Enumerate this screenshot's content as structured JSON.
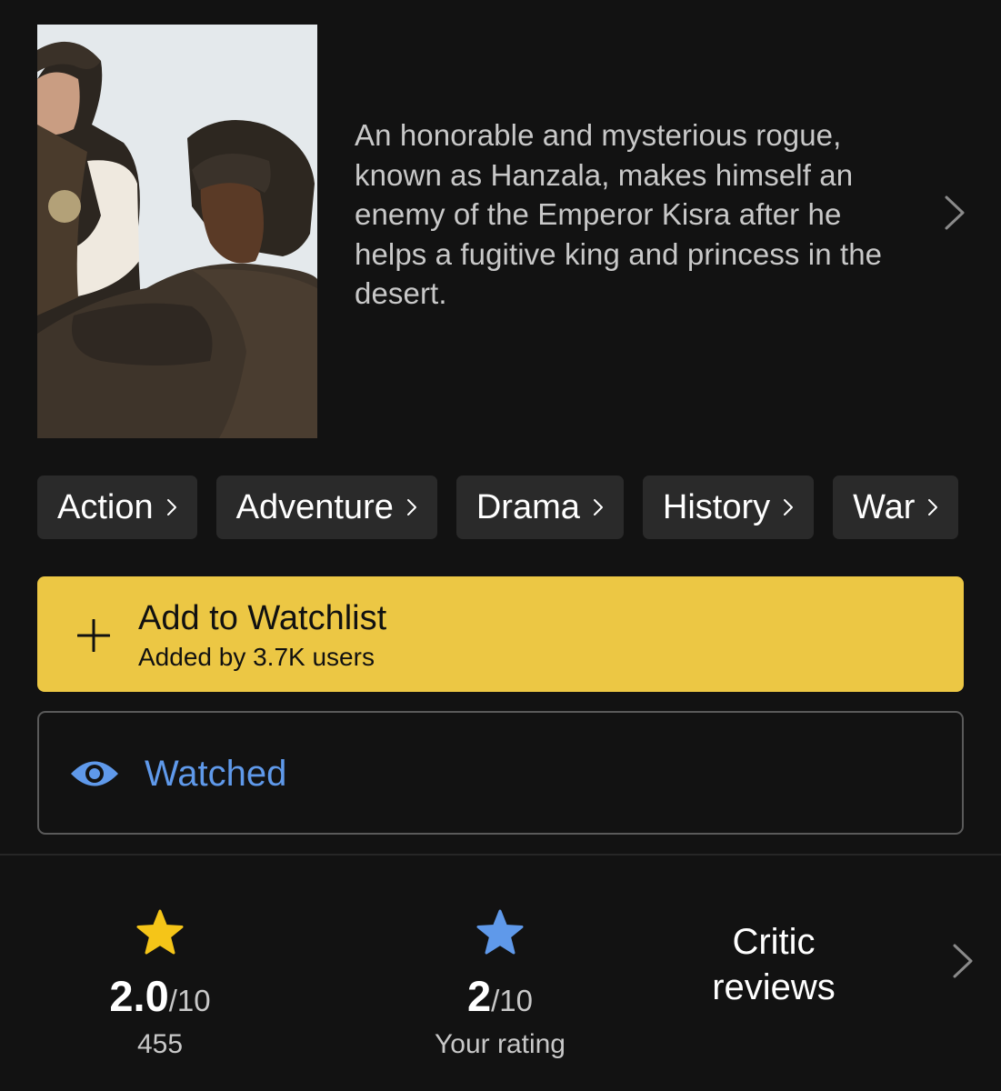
{
  "plot": {
    "text": "An honorable and mysterious rogue, known as Hanzala, makes himself an enemy of the Emperor Kisra after he helps a fugitive king and princess in the desert."
  },
  "genres": [
    {
      "label": "Action"
    },
    {
      "label": "Adventure"
    },
    {
      "label": "Drama"
    },
    {
      "label": "History"
    },
    {
      "label": "War"
    }
  ],
  "watchlist": {
    "title": "Add to Watchlist",
    "subtitle": "Added by 3.7K users",
    "icon": "plus-icon",
    "color": "#ecc744"
  },
  "watched": {
    "label": "Watched",
    "icon": "eye-icon",
    "color": "#5f99ea"
  },
  "ratings": {
    "imdb": {
      "score": "2.0",
      "out_of": "/10",
      "count": "455",
      "icon": "star-icon",
      "color": "#f5c518"
    },
    "user": {
      "score": "2",
      "out_of": "/10",
      "label": "Your rating",
      "icon": "star-icon",
      "color": "#5f99ea"
    },
    "critic": {
      "label": "Critic reviews"
    }
  }
}
